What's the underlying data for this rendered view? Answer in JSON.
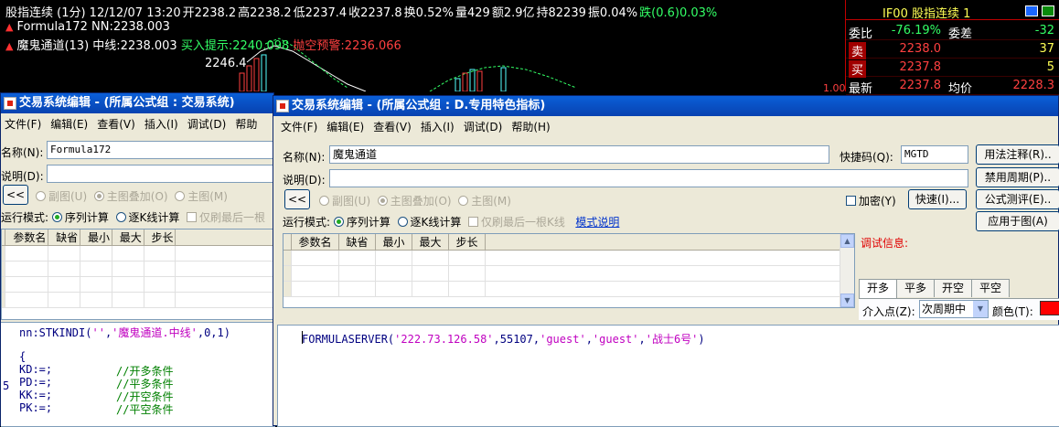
{
  "chart": {
    "info": [
      {
        "text": "股指连续 (1分) 12/12/07 13:20",
        "color": "#ffffff"
      },
      {
        "text": "开2238.2",
        "color": "#ffffff"
      },
      {
        "text": "高2238.2",
        "color": "#ffffff"
      },
      {
        "text": "低2237.4",
        "color": "#ffffff"
      },
      {
        "text": "收2237.8",
        "color": "#ffffff"
      },
      {
        "text": "换0.52%",
        "color": "#ffffff"
      },
      {
        "text": "量429",
        "color": "#ffffff"
      },
      {
        "text": "额2.9亿",
        "color": "#ffffff"
      },
      {
        "text": "持82239",
        "color": "#ffffff"
      },
      {
        "text": "振0.04%",
        "color": "#ffffff"
      },
      {
        "text": "跌(0.6)0.03%",
        "color": "#33ff66"
      }
    ],
    "legend1": {
      "name": "Formula172",
      "value": "NN:2238.003"
    },
    "legend2": {
      "name": "魔鬼通道(13)",
      "mid": "中线:2238.003",
      "buy": "买入提示:2240.098",
      "sell": "抛空预警:2236.066"
    },
    "price_label": "2246.4",
    "right_edge_label": "1.00%"
  },
  "quote": {
    "title": "IF00  股指连续  1",
    "rows": [
      {
        "l1": "委比",
        "v1": "-76.19%",
        "l2": "委差",
        "v2": "-32",
        "c1": "#33ff66",
        "c2": "#33ff66"
      },
      {
        "l1": "卖",
        "v1": "2238.0",
        "l2": "",
        "v2": "37",
        "c1": "#ff4040",
        "c2": "#ffff55"
      },
      {
        "l1": "买",
        "v1": "2237.8",
        "l2": "",
        "v2": "5",
        "c1": "#ff4040",
        "c2": "#ffff55"
      },
      {
        "l1": "最新",
        "v1": "2237.8",
        "l2": "均价",
        "v2": "2228.3",
        "c1": "#ff4040",
        "c2": "#ff4040"
      }
    ]
  },
  "dialog1": {
    "title": "交易系统编辑 - (所属公式组 : 交易系统)",
    "menu": [
      "文件(F)",
      "编辑(E)",
      "查看(V)",
      "插入(I)",
      "调试(D)",
      "帮助"
    ],
    "name_label": "名称(N):",
    "name_value": "Formula172",
    "desc_label": "说明(D):",
    "collapse_btn": "<<",
    "chart_opts": [
      "副图(U)",
      "主图叠加(O)",
      "主图(M)"
    ],
    "run_mode_label": "运行模式:",
    "run_opts": [
      "序列计算",
      "逐K线计算"
    ],
    "refresh_only": "仅刷最后一根",
    "param_headers": [
      "参数名",
      "缺省",
      "最小",
      "最大",
      "步长"
    ],
    "code": [
      {
        "text": "nn:STKINDI('','魔鬼通道.中线',0,1)",
        "type": "mixed"
      },
      {
        "text": "",
        "type": "plain"
      },
      {
        "text": "{",
        "type": "plain"
      },
      {
        "text": "KD:=;",
        "comment": "//开多条件"
      },
      {
        "text": "PD:=;",
        "comment": "//平多条件"
      },
      {
        "text": "KK:=;",
        "comment": "//开空条件"
      },
      {
        "text": "PK:=;",
        "comment": "//平空条件"
      }
    ],
    "line_number": "5"
  },
  "dialog2": {
    "title": "交易系统编辑 - (所属公式组 : D.专用特色指标)",
    "menu": [
      "文件(F)",
      "编辑(E)",
      "查看(V)",
      "插入(I)",
      "调试(D)",
      "帮助(H)"
    ],
    "name_label": "名称(N):",
    "name_value": "魔鬼通道",
    "hotkey_label": "快捷码(Q):",
    "hotkey_value": "MGTD",
    "desc_label": "说明(D):",
    "collapse_btn": "<<",
    "chart_opts": [
      "副图(U)",
      "主图叠加(O)",
      "主图(M)"
    ],
    "encrypt_label": "加密(Y)",
    "quick_btn": "快速(I)...",
    "run_mode_label": "运行模式:",
    "run_opts": [
      "序列计算",
      "逐K线计算"
    ],
    "refresh_only": "仅刷最后一根K线",
    "mode_help": "模式说明",
    "param_headers": [
      "参数名",
      "缺省",
      "最小",
      "最大",
      "步长"
    ],
    "debug_label": "调试信息:",
    "side_buttons": [
      "用法注释(R)..",
      "禁用周期(P)..",
      "公式测评(E)..",
      "应用于图(A)"
    ],
    "tabs": [
      "开多",
      "平多",
      "开空",
      "平空"
    ],
    "entry_label": "介入点(Z):",
    "entry_value": "次周期中",
    "color_label": "颜色(T):",
    "code": {
      "fn": "FORMULASERVER(",
      "args": [
        {
          "t": "'222.73.126.58'",
          "s": true
        },
        {
          "t": ",55107,",
          "s": false
        },
        {
          "t": "'guest'",
          "s": true
        },
        {
          "t": ",",
          "s": false
        },
        {
          "t": "'guest'",
          "s": true
        },
        {
          "t": ",",
          "s": false
        },
        {
          "t": "'战士6号'",
          "s": true
        },
        {
          "t": ")",
          "s": false
        }
      ]
    }
  },
  "colors": {
    "string": "#c000c0",
    "comment": "#008000",
    "code": "#000080",
    "swatch": "#ff0000"
  }
}
